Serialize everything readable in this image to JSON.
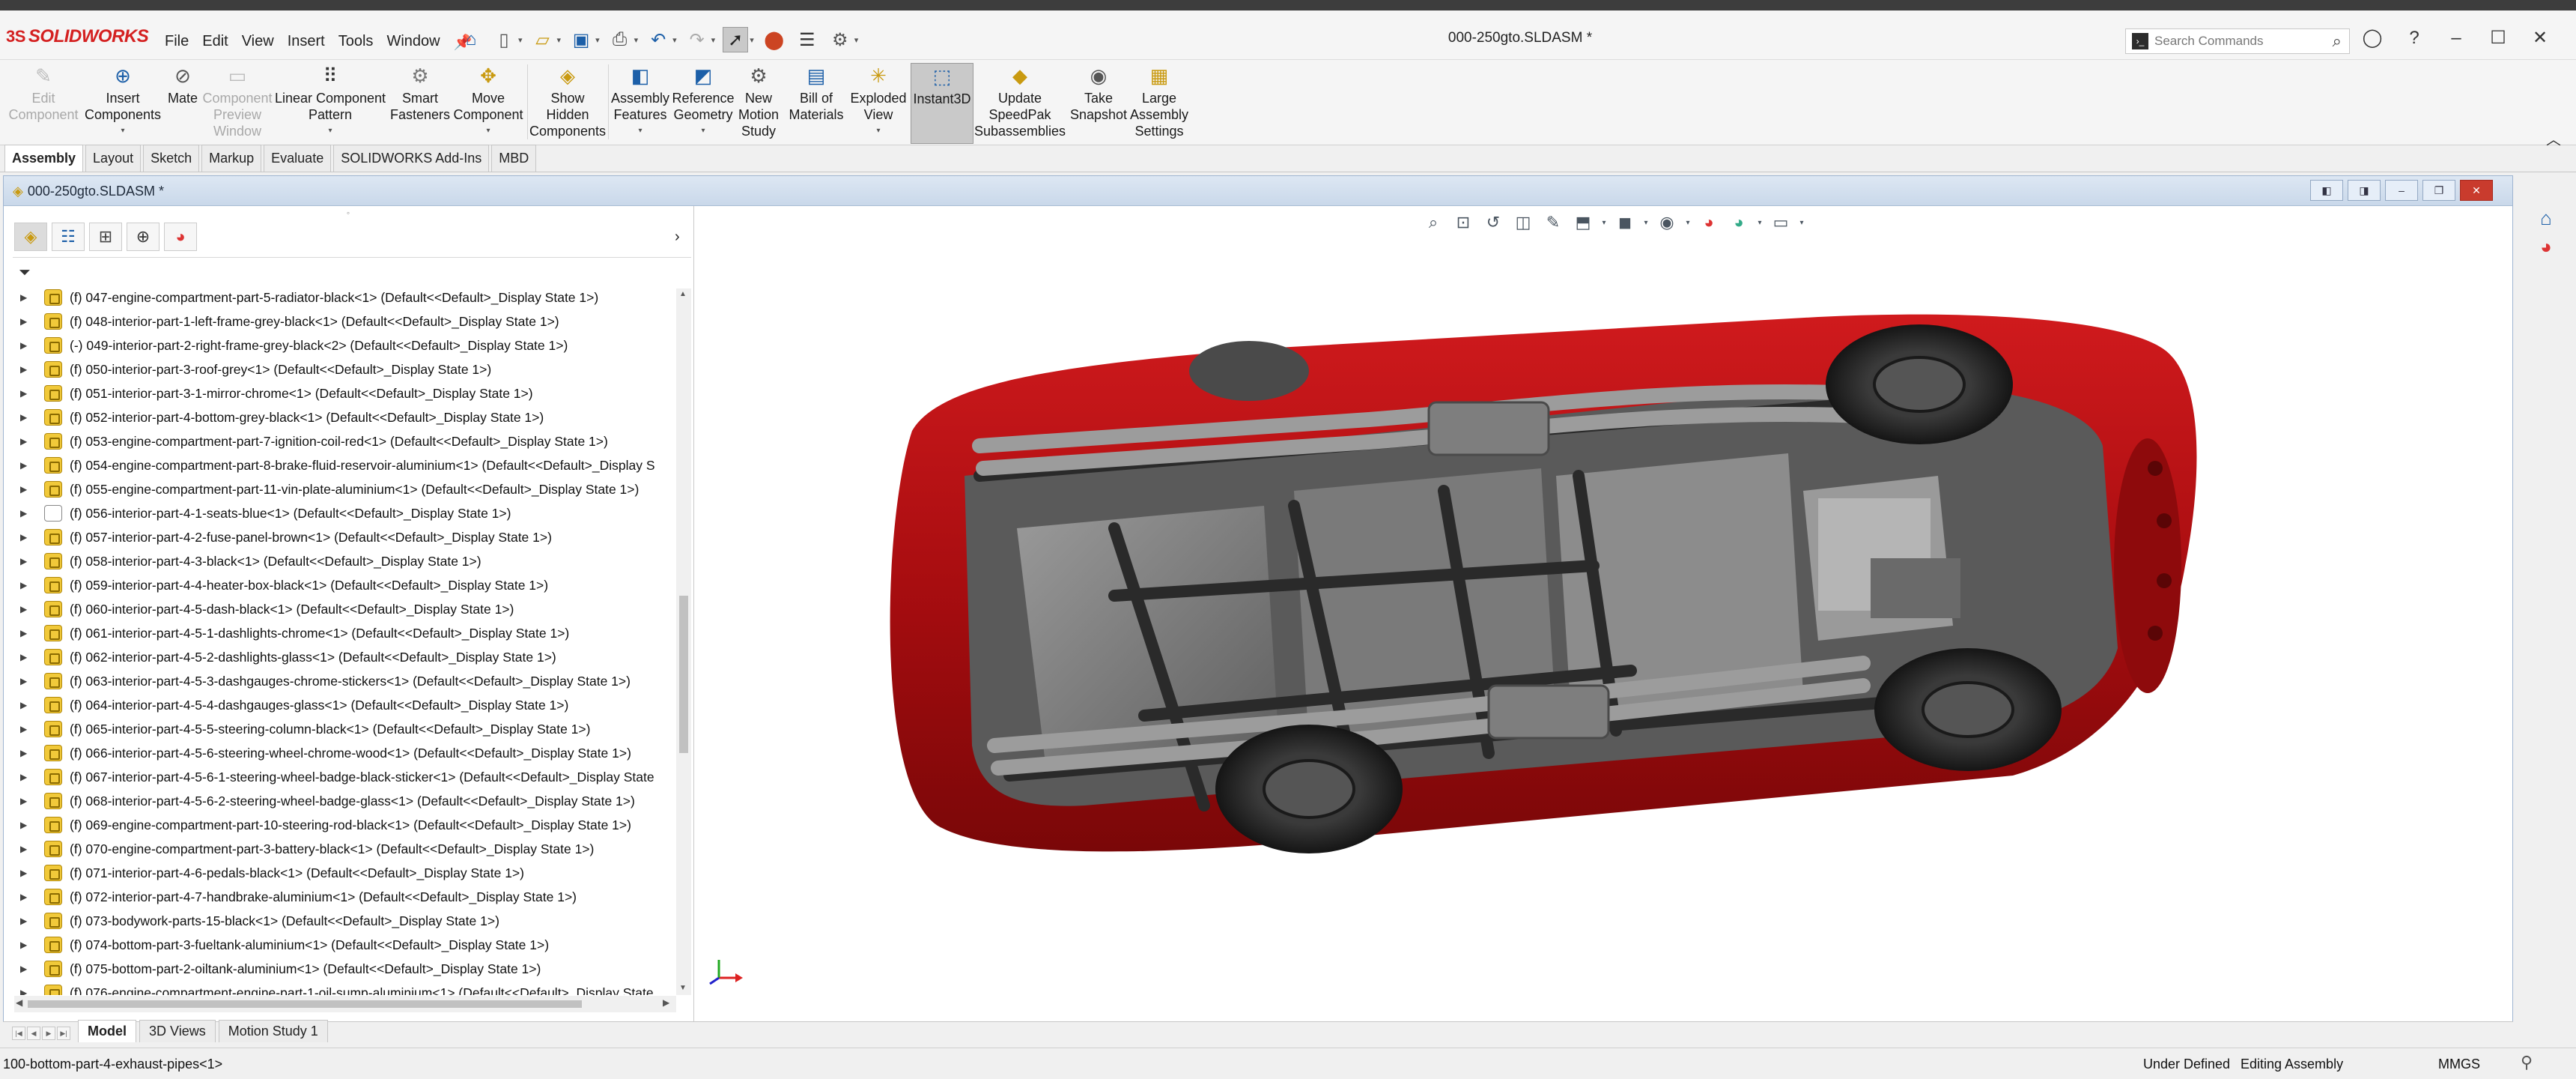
{
  "app": {
    "logo_text": "SOLIDWORKS",
    "logo_symbol": "3S",
    "document_title": "000-250gto.SLDASM *",
    "search_placeholder": "Search Commands",
    "brand_color": "#d42020"
  },
  "menu": [
    "File",
    "Edit",
    "View",
    "Insert",
    "Tools",
    "Window"
  ],
  "ribbon": [
    {
      "label": "Edit Component",
      "icon": "edit-component-icon",
      "enabled": false
    },
    {
      "label": "Insert Components",
      "icon": "insert-components-icon",
      "enabled": true
    },
    {
      "label": "Mate",
      "icon": "mate-icon",
      "enabled": true
    },
    {
      "label": "Component Preview Window",
      "icon": "component-preview-icon",
      "enabled": false
    },
    {
      "label": "Linear Component Pattern",
      "icon": "linear-pattern-icon",
      "enabled": true
    },
    {
      "label": "Smart Fasteners",
      "icon": "smart-fasteners-icon",
      "enabled": true
    },
    {
      "label": "Move Component",
      "icon": "move-component-icon",
      "enabled": true
    },
    {
      "label": "Show Hidden Components",
      "icon": "show-hidden-icon",
      "enabled": true
    },
    {
      "label": "Assembly Features",
      "icon": "assembly-features-icon",
      "enabled": true
    },
    {
      "label": "Reference Geometry",
      "icon": "reference-geometry-icon",
      "enabled": true
    },
    {
      "label": "New Motion Study",
      "icon": "motion-study-icon",
      "enabled": true
    },
    {
      "label": "Bill of Materials",
      "icon": "bom-icon",
      "enabled": true
    },
    {
      "label": "Exploded View",
      "icon": "exploded-view-icon",
      "enabled": true
    },
    {
      "label": "Instant3D",
      "icon": "instant3d-icon",
      "enabled": true,
      "active": true
    },
    {
      "label": "Update SpeedPak Subassemblies",
      "icon": "speedpak-icon",
      "enabled": true
    },
    {
      "label": "Take Snapshot",
      "icon": "snapshot-icon",
      "enabled": true
    },
    {
      "label": "Large Assembly Settings",
      "icon": "large-assembly-icon",
      "enabled": true
    }
  ],
  "cm_tabs": [
    "Assembly",
    "Layout",
    "Sketch",
    "Markup",
    "Evaluate",
    "SOLIDWORKS Add-Ins",
    "MBD"
  ],
  "doc_window_title": "000-250gto.SLDASM *",
  "tree_items": [
    "(f) 047-engine-compartment-part-5-radiator-black<1> (Default<<Default>_Display State 1>)",
    "(f) 048-interior-part-1-left-frame-grey-black<1> (Default<<Default>_Display State 1>)",
    "(-) 049-interior-part-2-right-frame-grey-black<2> (Default<<Default>_Display State 1>)",
    "(f) 050-interior-part-3-roof-grey<1> (Default<<Default>_Display State 1>)",
    "(f) 051-interior-part-3-1-mirror-chrome<1> (Default<<Default>_Display State 1>)",
    "(f) 052-interior-part-4-bottom-grey-black<1> (Default<<Default>_Display State 1>)",
    "(f) 053-engine-compartment-part-7-ignition-coil-red<1> (Default<<Default>_Display State 1>)",
    "(f) 054-engine-compartment-part-8-brake-fluid-reservoir-aluminium<1> (Default<<Default>_Display S",
    "(f) 055-engine-compartment-part-11-vin-plate-aluminium<1> (Default<<Default>_Display State 1>)",
    "(f) 056-interior-part-4-1-seats-blue<1> (Default<<Default>_Display State 1>)",
    "(f) 057-interior-part-4-2-fuse-panel-brown<1> (Default<<Default>_Display State 1>)",
    "(f) 058-interior-part-4-3-black<1> (Default<<Default>_Display State 1>)",
    "(f) 059-interior-part-4-4-heater-box-black<1> (Default<<Default>_Display State 1>)",
    "(f) 060-interior-part-4-5-dash-black<1> (Default<<Default>_Display State 1>)",
    "(f) 061-interior-part-4-5-1-dashlights-chrome<1> (Default<<Default>_Display State 1>)",
    "(f) 062-interior-part-4-5-2-dashlights-glass<1> (Default<<Default>_Display State 1>)",
    "(f) 063-interior-part-4-5-3-dashgauges-chrome-stickers<1> (Default<<Default>_Display State 1>)",
    "(f) 064-interior-part-4-5-4-dashgauges-glass<1> (Default<<Default>_Display State 1>)",
    "(f) 065-interior-part-4-5-5-steering-column-black<1> (Default<<Default>_Display State 1>)",
    "(f) 066-interior-part-4-5-6-steering-wheel-chrome-wood<1> (Default<<Default>_Display State 1>)",
    "(f) 067-interior-part-4-5-6-1-steering-wheel-badge-black-sticker<1> (Default<<Default>_Display State",
    "(f) 068-interior-part-4-5-6-2-steering-wheel-badge-glass<1> (Default<<Default>_Display State 1>)",
    "(f) 069-engine-compartment-part-10-steering-rod-black<1> (Default<<Default>_Display State 1>)",
    "(f) 070-engine-compartment-part-3-battery-black<1> (Default<<Default>_Display State 1>)",
    "(f) 071-interior-part-4-6-pedals-black<1> (Default<<Default>_Display State 1>)",
    "(f) 072-interior-part-4-7-handbrake-aluminium<1> (Default<<Default>_Display State 1>)",
    "(f) 073-bodywork-parts-15-black<1> (Default<<Default>_Display State 1>)",
    "(f) 074-bottom-part-3-fueltank-aluminium<1> (Default<<Default>_Display State 1>)",
    "(f) 075-bottom-part-2-oiltank-aluminium<1> (Default<<Default>_Display State 1>)",
    "(f) 076-engine-compartment-engine-part-1-oil-sump-aluminium<1> (Default<<Default>_Display State"
  ],
  "bottom_tabs": [
    "Model",
    "3D Views",
    "Motion Study 1"
  ],
  "status": {
    "left": "100-bottom-part-4-exhaust-pipes<1>",
    "definition": "Under Defined",
    "mode": "Editing Assembly",
    "units": "MMGS"
  },
  "colors": {
    "car_body": "#b30f12",
    "chassis": "#6e6e6e",
    "tire": "#1e1e1e"
  }
}
